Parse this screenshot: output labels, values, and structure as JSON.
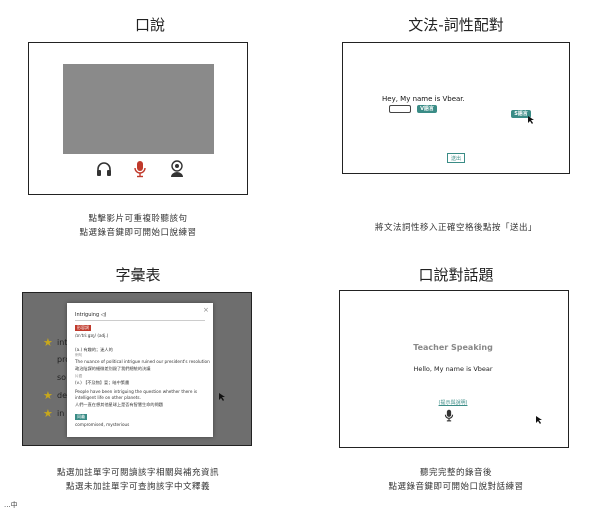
{
  "panels": {
    "speaking": {
      "title": "口說",
      "caption": [
        "點擊影片可重複聆聽該句",
        "點選錄音鍵即可開始口說練習"
      ],
      "icons": [
        "headphones-icon",
        "microphone-icon",
        "speaker-avatar-icon"
      ],
      "mic_color": "#c0392b"
    },
    "grammar": {
      "title": "文法-詞性配對",
      "sentence": "Hey, My name is Vbear.",
      "chip_in_blank": "V語言",
      "chip_dragging": "S語言",
      "submit_label": "送出",
      "caption": [
        "將文法詞性移入正確空格後點按「送出」"
      ],
      "accent": "#3a8c86"
    },
    "vocabulary": {
      "title": "字彙表",
      "list": [
        "int",
        "pro",
        "so",
        "de",
        "in"
      ],
      "modal": {
        "word": "Intriguing ◁)",
        "close": "×",
        "tag_adj": "形容詞",
        "phonetic": "/ɪnˈtriːgɪŋ/ (adj.)",
        "meaning": "(a.) 有趣的；迷人的",
        "example_label": "例句",
        "example_en": "The nuance of political intrigue ruined our president's resolution",
        "example_zh": "政治陰謀的細微差別毀了我們總統的決議",
        "group_label": "片語",
        "phrase": "(v.) 【不及物】耍；暗中策畫",
        "example2_en": "People have been intriguing the question whether there is",
        "example2_en_b": "intelligent life on other planets.",
        "example2_zh": "人們一直在想其他星球上是否有智慧生命的問題",
        "tag_syn": "同義",
        "synonyms": "compromised, mysterious"
      },
      "caption": [
        "點選加註單字可閱讀該字相關與補充資訊",
        "點選未加註單字可查詢該字中文釋義"
      ],
      "star_color": "#c8a81b"
    },
    "topic": {
      "title": "口說對話題",
      "heading": "Teacher Speaking",
      "line": "Hello, My name is Vbear",
      "hint": "(提示與說明)",
      "caption": [
        "聽完完整的錄音後",
        "點選錄音鍵即可開始口說對話練習"
      ]
    }
  },
  "footer": "...中"
}
